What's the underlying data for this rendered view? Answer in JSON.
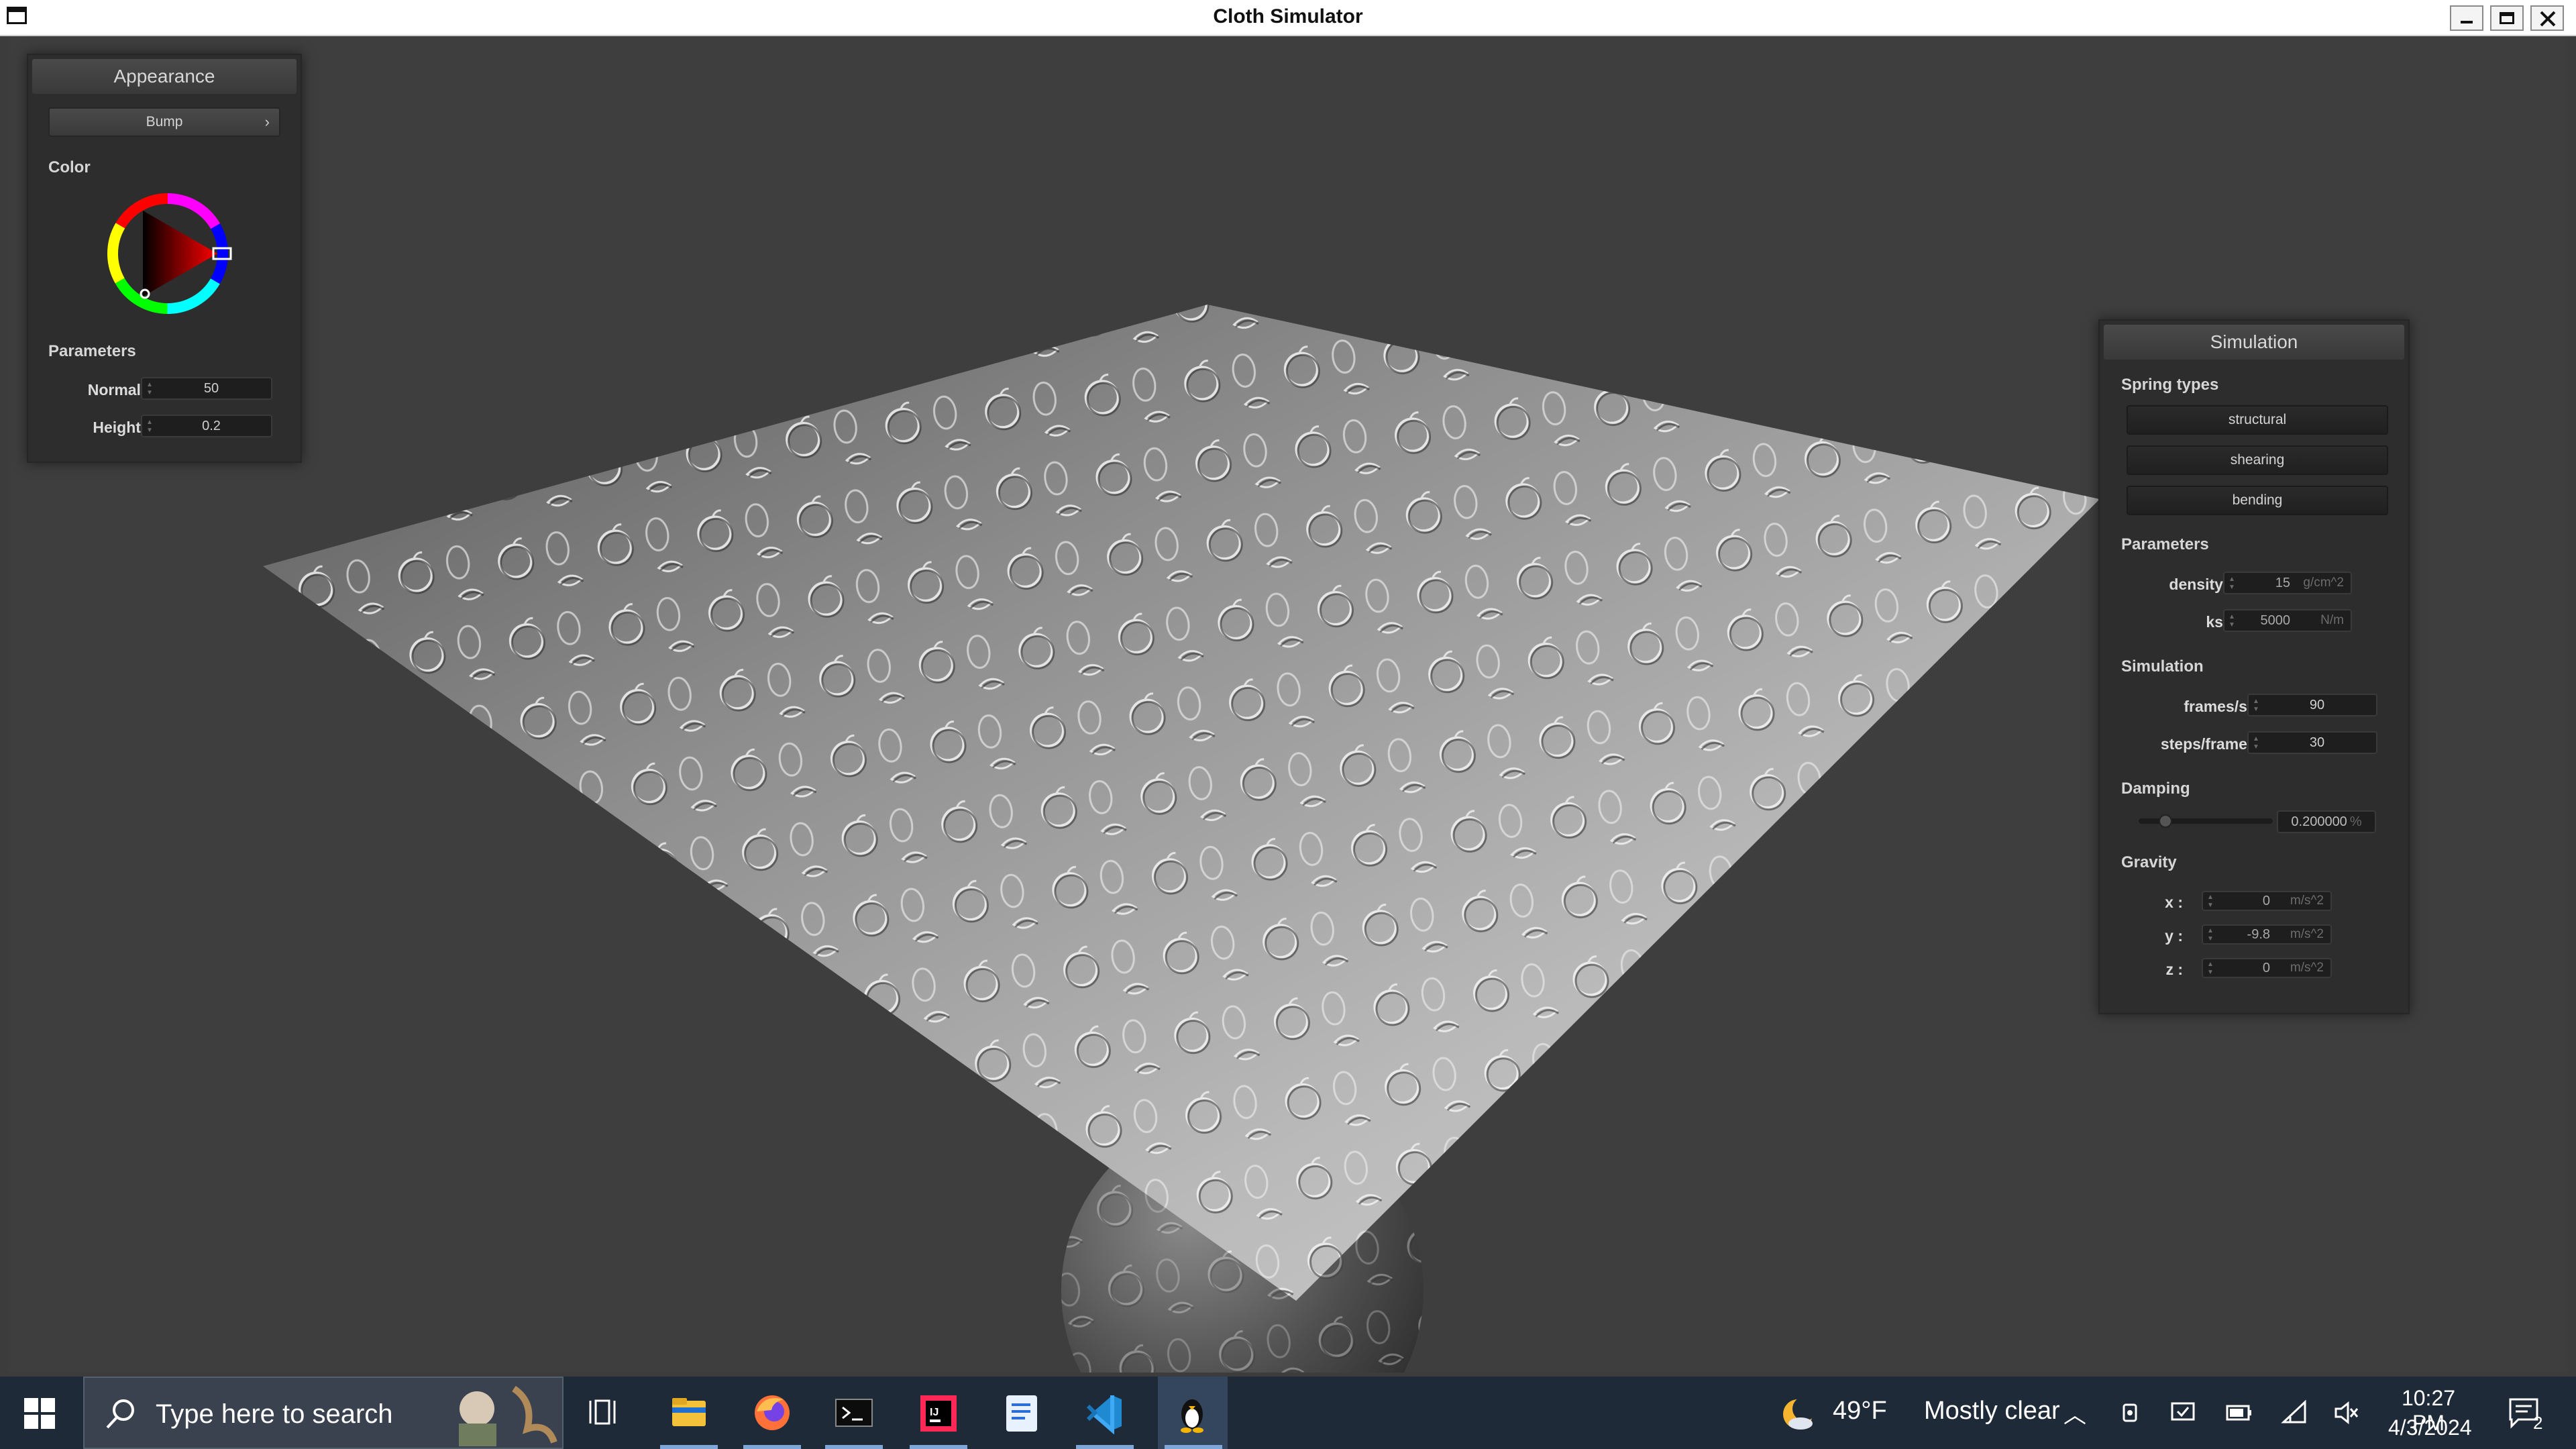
{
  "window": {
    "title": "Cloth Simulator",
    "controls": [
      "minimize-icon",
      "maximize-icon",
      "close-icon"
    ]
  },
  "appearance": {
    "header": "Appearance",
    "mode_value": "Bump",
    "color_label": "Color",
    "parameters_label": "Parameters",
    "normal_label": "Normal :",
    "normal_value": "50",
    "height_label": "Height :",
    "height_value": "0.2",
    "selected_color": "#ff0000"
  },
  "simulation_panel": {
    "header": "Simulation",
    "spring_types_label": "Spring types",
    "spring_types": [
      "structural",
      "shearing",
      "bending"
    ],
    "parameters_label": "Parameters",
    "density_label": "density :",
    "density_value": "15",
    "density_unit": "g/cm^2",
    "ks_label": "ks :",
    "ks_value": "5000",
    "ks_unit": "N/m",
    "simulation_label": "Simulation",
    "fps_label": "frames/s :",
    "fps_value": "90",
    "steps_label": "steps/frame :",
    "steps_value": "30",
    "damping_label": "Damping",
    "damping_value": "0.200000",
    "damping_unit": "%",
    "damping_fraction": 0.2,
    "gravity_label": "Gravity",
    "gx_label": "x :",
    "gx_value": "0",
    "gy_label": "y :",
    "gy_value": "-9.8",
    "gz_label": "z :",
    "gz_value": "0",
    "gravity_unit": "m/s^2"
  },
  "taskbar": {
    "search_placeholder": "Type here to search",
    "apps": [
      "task-view-icon",
      "file-explorer-icon",
      "firefox-icon",
      "terminal-icon",
      "intellij-icon",
      "notepad-icon",
      "vscode-icon",
      "tux-icon"
    ],
    "weather_temp": "49°F",
    "weather_desc": "Mostly clear",
    "time": "10:27 PM",
    "date": "4/3/2024",
    "notification_count": "2",
    "accent": "#7ea6d8"
  }
}
